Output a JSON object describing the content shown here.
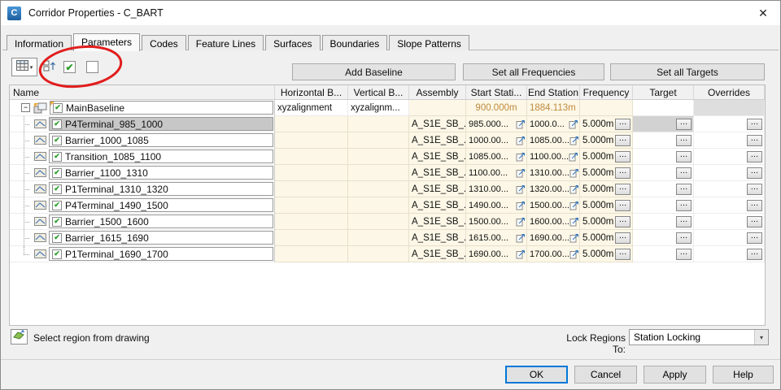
{
  "window": {
    "title": "Corridor Properties - C_BART",
    "app_icon_letter": "C",
    "close_glyph": "✕"
  },
  "tabs": [
    {
      "label": "Information"
    },
    {
      "label": "Parameters"
    },
    {
      "label": "Codes"
    },
    {
      "label": "Feature Lines"
    },
    {
      "label": "Surfaces"
    },
    {
      "label": "Boundaries"
    },
    {
      "label": "Slope Patterns"
    }
  ],
  "toolbar": {
    "add_baseline": "Add Baseline",
    "set_all_frequencies": "Set all Frequencies",
    "set_all_targets": "Set all Targets"
  },
  "annotation": {
    "color": "#e11d1d"
  },
  "table": {
    "columns": [
      "Name",
      "Horizontal B...",
      "Vertical B...",
      "Assembly",
      "Start Stati...",
      "End Station",
      "Frequency",
      "Target",
      "Overrides"
    ],
    "baseline": {
      "name": "MainBaseline",
      "horizontal": "xyzalignment",
      "vertical": "xyzalignm...",
      "start_station": "900.000m",
      "end_station": "1884.113m"
    },
    "regions": [
      {
        "name": "P4Terminal_985_1000",
        "assembly": "A_S1E_SB_...",
        "start": "985.000...",
        "end": "1000.0...",
        "frequency": "5.000m",
        "selected": true
      },
      {
        "name": "Barrier_1000_1085",
        "assembly": "A_S1E_SB_...",
        "start": "1000.00...",
        "end": "1085.00...",
        "frequency": "5.000m"
      },
      {
        "name": "Transition_1085_1100",
        "assembly": "A_S1E_SB_...",
        "start": "1085.00...",
        "end": "1100.00...",
        "frequency": "5.000m"
      },
      {
        "name": "Barrier_1100_1310",
        "assembly": "A_S1E_SB_...",
        "start": "1100.00...",
        "end": "1310.00...",
        "frequency": "5.000m"
      },
      {
        "name": "P1Terminal_1310_1320",
        "assembly": "A_S1E_SB_...",
        "start": "1310.00...",
        "end": "1320.00...",
        "frequency": "5.000m"
      },
      {
        "name": "P4Terminal_1490_1500",
        "assembly": "A_S1E_SB_...",
        "start": "1490.00...",
        "end": "1500.00...",
        "frequency": "5.000m"
      },
      {
        "name": "Barrier_1500_1600",
        "assembly": "A_S1E_SB_...",
        "start": "1500.00...",
        "end": "1600.00...",
        "frequency": "5.000m"
      },
      {
        "name": "Barrier_1615_1690",
        "assembly": "A_S1E_SB_...",
        "start": "1615.00...",
        "end": "1690.00...",
        "frequency": "5.000m"
      },
      {
        "name": "P1Terminal_1690_1700",
        "assembly": "A_S1E_SB_...",
        "start": "1690.00...",
        "end": "1700.00...",
        "frequency": "5.000m"
      }
    ]
  },
  "footer": {
    "select_region_label": "Select region from drawing",
    "lock_regions_label": "Lock Regions To:",
    "lock_regions_value": "Station Locking"
  },
  "buttons": {
    "ok": "OK",
    "cancel": "Cancel",
    "apply": "Apply",
    "help": "Help"
  },
  "ui": {
    "check": "✔",
    "ellipsis": "…",
    "expander_minus": "−",
    "caret": "▾"
  }
}
